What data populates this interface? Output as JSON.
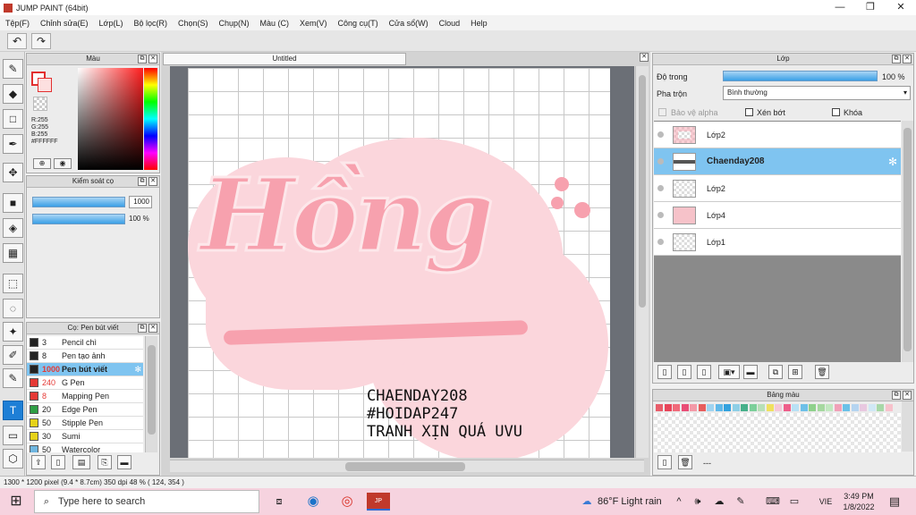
{
  "window": {
    "title": "JUMP PAINT (64bit)",
    "controls": [
      "—",
      "❐",
      "✕"
    ]
  },
  "menu": [
    "Tệp(F)",
    "Chỉnh sửa(E)",
    "Lớp(L)",
    "Bộ lọc(R)",
    "Chọn(S)",
    "Chụp(N)",
    "Màu (C)",
    "Xem(V)",
    "Công cụ(T)",
    "Cửa sổ(W)",
    "Cloud",
    "Help"
  ],
  "toolbar": {
    "undo_icon": "↶",
    "redo_icon": "↷"
  },
  "tools": [
    "✎",
    "◆",
    "□",
    "✒",
    "✥",
    "■",
    "◈",
    "▦",
    "⬚",
    "◌",
    "✦",
    "✐",
    "✎",
    "T",
    "▭",
    "⬡"
  ],
  "color_panel": {
    "title": "Màu",
    "r": "R:255",
    "g": "G:255",
    "b": "B:255",
    "hex": "#FFFFFF",
    "primary_color": "#ffffff",
    "accent": "#e23030"
  },
  "brush_control": {
    "title": "Kiểm soát cọ",
    "size": "1000",
    "opacity": "100 %"
  },
  "brush_list": {
    "title": "Cọ: Pen bút viết",
    "items": [
      {
        "size": "3",
        "name": "Pencil chì",
        "color": "#222222"
      },
      {
        "size": "8",
        "name": "Pen tạo ảnh",
        "color": "#222222"
      },
      {
        "size": "1000",
        "name": "Pen bút viết",
        "color": "#222222",
        "selected": true
      },
      {
        "size": "240",
        "name": "G Pen",
        "color": "#e53935"
      },
      {
        "size": "8",
        "name": "Mapping Pen",
        "color": "#e53935"
      },
      {
        "size": "20",
        "name": "Edge Pen",
        "color": "#2e9e44"
      },
      {
        "size": "50",
        "name": "Stipple Pen",
        "color": "#e6d21a"
      },
      {
        "size": "30",
        "name": "Sumi",
        "color": "#e6d21a"
      },
      {
        "size": "50",
        "name": "Watercolor",
        "color": "#6fb6e0"
      }
    ]
  },
  "document": {
    "tab": "Untitled"
  },
  "artwork": {
    "lettering": "Hồng",
    "credit_lines": [
      "CHAENDAY208",
      "#HOIDAP247",
      "TRANH XỊN QUÁ UVU"
    ]
  },
  "layers_panel": {
    "title": "Lớp",
    "opacity_label": "Độ trong",
    "opacity_value": "100 %",
    "blend_label": "Pha trộn",
    "blend_value": "Bình thường",
    "protect_alpha": "Bảo vệ alpha",
    "clip": "Xén bớt",
    "lock": "Khóa",
    "layers": [
      {
        "name": "Lớp2"
      },
      {
        "name": "Chaenday208",
        "selected": true
      },
      {
        "name": "Lớp2"
      },
      {
        "name": "Lớp4"
      },
      {
        "name": "Lớp1"
      }
    ]
  },
  "palette": {
    "title": "Bảng màu",
    "status": "---",
    "colors": [
      "#e85d6a",
      "#e8455a",
      "#f06a7a",
      "#e94e77",
      "#f39aa8",
      "#e75d5d",
      "#9fd3f0",
      "#5fb8e8",
      "#33a2de",
      "#8ecfe6",
      "#47b08a",
      "#7ccf9a",
      "#b8e0b8",
      "#f0e060",
      "#f5c8d8",
      "#ee5f8a",
      "#b9e1f5",
      "#6ec0e8",
      "#8fd18c",
      "#a6d8a0",
      "#c2e8c0",
      "#f1a1b8",
      "#6ac1e8",
      "#b5d4f0",
      "#e8c8e0",
      "#d0e8f5",
      "#a8d8a8",
      "#f7c2cc"
    ]
  },
  "status_bar": {
    "size": "1300 * 1200 pixel",
    "physical": "(9.4 * 8.7cm)",
    "dpi": "350 dpi",
    "zoom": "48 %",
    "coords": "( 124, 354 )"
  },
  "taskbar": {
    "search_placeholder": "Type here to search",
    "weather": "86°F  Light rain",
    "lang": "VIE",
    "time": "3:49 PM",
    "date": "1/8/2022"
  }
}
